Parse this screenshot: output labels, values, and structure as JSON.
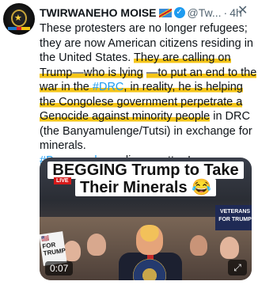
{
  "tweet": {
    "author_name": "TWIRWANEHO MOISE",
    "handle": "@Tw...",
    "separator": "·",
    "time": "4h",
    "paragraph1": {
      "p1": "These protesters are no longer refugees; they are now American citizens residing in the United States. ",
      "hl1": "They are calling on Trump—who is lying",
      "p2": " ",
      "hl2": "—to put an end to the war in the ",
      "hashtag1": "#DRC",
      "hl3": ", in reality, he is helping the Congolese government perpetrate a Genocide against minority people",
      "p3": " in DRC (the Banyamulenge/Tutsi) in exchange for minerals."
    },
    "paragraph2": {
      "hashtag": "#Banyamulenge",
      "text": " lives matter !"
    }
  },
  "media": {
    "banner_line1": "BEGGING Trump to Take",
    "banner_line2": "Their Minerals 😂",
    "live_badge": "LIVE",
    "sign_left": "🇺🇸 FOR TRUMP",
    "sign_right": "VETERANS FOR TRUMP",
    "duration": "0:07"
  },
  "icons": {
    "more": "more-icon",
    "verified": "verified-badge-icon",
    "expand": "expand-icon"
  },
  "colors": {
    "link": "#1d9bf0",
    "highlight": "#f5c518",
    "verified": "#1d9bf0"
  }
}
